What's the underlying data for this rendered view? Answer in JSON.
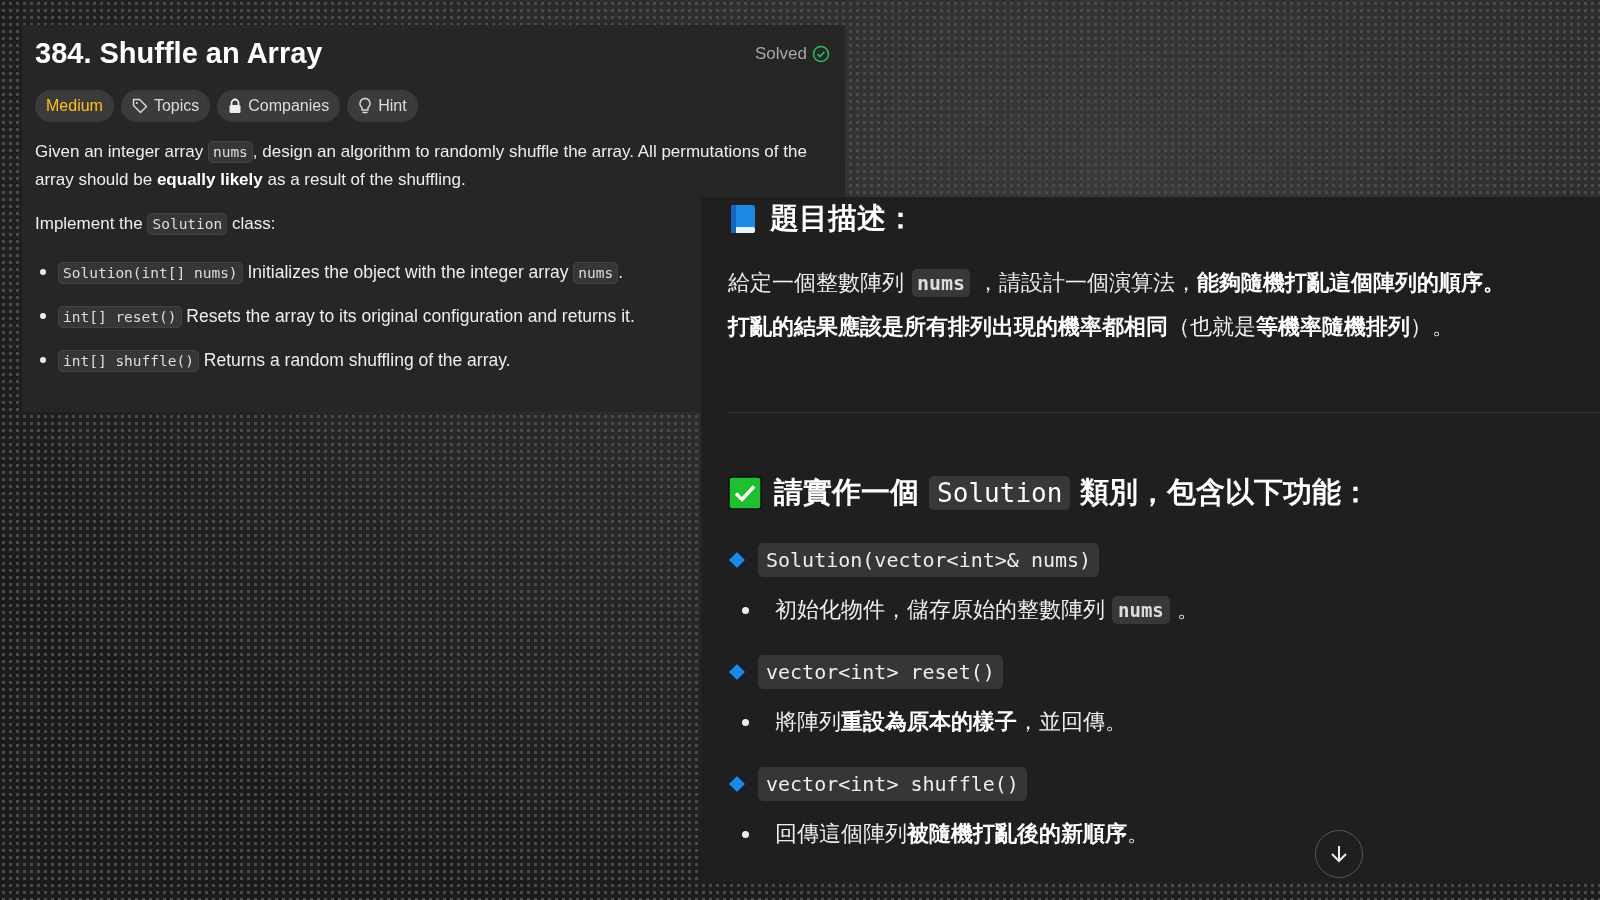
{
  "problem": {
    "title": "384. Shuffle an Array",
    "status": "Solved",
    "solved": true,
    "tags": [
      {
        "label": "Medium",
        "kind": "difficulty"
      },
      {
        "label": "Topics",
        "kind": "tag"
      },
      {
        "label": "Companies",
        "kind": "lock"
      },
      {
        "label": "Hint",
        "kind": "bulb"
      }
    ],
    "description": [
      {
        "kind": "text",
        "text": "Given an integer array "
      },
      {
        "kind": "code",
        "text": "nums"
      },
      {
        "kind": "text",
        "text": ", design an algorithm to randomly shuffle the array. All permutations of the array should be "
      },
      {
        "kind": "bold",
        "text": "equally likely"
      },
      {
        "kind": "text",
        "text": " as a result of the shuffling."
      }
    ],
    "intro": [
      {
        "kind": "text",
        "text": "Implement the "
      },
      {
        "kind": "code",
        "text": "Solution"
      },
      {
        "kind": "text",
        "text": " class:"
      }
    ],
    "methods": [
      [
        {
          "kind": "code",
          "text": "Solution(int[] nums)"
        },
        {
          "kind": "text",
          "text": " Initializes the object with the integer array "
        },
        {
          "kind": "code",
          "text": "nums"
        },
        {
          "kind": "text",
          "text": "."
        }
      ],
      [
        {
          "kind": "code",
          "text": "int[] reset()"
        },
        {
          "kind": "text",
          "text": " Resets the array to its original configuration and returns it."
        }
      ],
      [
        {
          "kind": "code",
          "text": "int[] shuffle()"
        },
        {
          "kind": "text",
          "text": " Returns a random shuffling of the array."
        }
      ]
    ]
  },
  "notes": {
    "description": {
      "heading": "題目描述：",
      "lines": [
        [
          {
            "kind": "text",
            "text": "給定一個整數陣列"
          },
          {
            "kind": "code",
            "text": "nums"
          },
          {
            "kind": "text",
            "text": " ，請設計一個演算法，"
          },
          {
            "kind": "bold",
            "text": "能夠隨機打亂這個陣列的順序。"
          }
        ],
        [
          {
            "kind": "bold",
            "text": "打亂的結果應該是所有排列出現的機率都相同"
          },
          {
            "kind": "text",
            "text": "（也就是"
          },
          {
            "kind": "bold",
            "text": "等機率隨機排列"
          },
          {
            "kind": "text",
            "text": "）。"
          }
        ]
      ]
    },
    "task": {
      "heading": [
        {
          "kind": "text",
          "text": "請實作一個 "
        },
        {
          "kind": "code",
          "text": "Solution"
        },
        {
          "kind": "text",
          "text": " 類別，包含以下功能："
        }
      ],
      "items": [
        {
          "signature": "Solution(vector<int>& nums)",
          "detail": [
            {
              "kind": "text",
              "text": "初始化物件，儲存原始的整數陣列 "
            },
            {
              "kind": "code",
              "text": "nums"
            },
            {
              "kind": "text",
              "text": " 。"
            }
          ]
        },
        {
          "signature": "vector<int> reset()",
          "detail": [
            {
              "kind": "text",
              "text": "將陣列"
            },
            {
              "kind": "bold",
              "text": "重設為原本的樣子"
            },
            {
              "kind": "text",
              "text": "，並回傳。"
            }
          ]
        },
        {
          "signature": "vector<int> shuffle()",
          "detail": [
            {
              "kind": "text",
              "text": "回傳這個陣列"
            },
            {
              "kind": "bold",
              "text": "被隨機打亂後的新順序"
            },
            {
              "kind": "text",
              "text": "。"
            }
          ]
        }
      ]
    }
  }
}
